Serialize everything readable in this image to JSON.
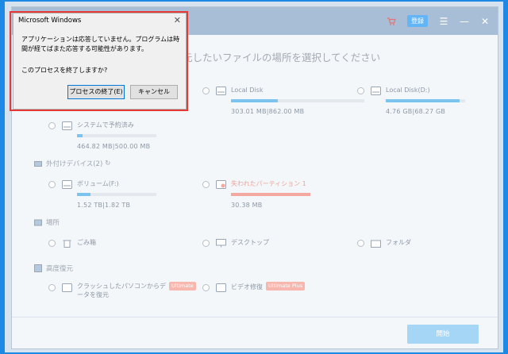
{
  "app": {
    "toolbar": {
      "login_label": "登録",
      "cart_icon": "cart-icon",
      "menu_icon": "menu-icon",
      "minimize_icon": "minimize-icon",
      "close_icon": "close-icon"
    },
    "headline": "元したいファイルの場所を選択してください",
    "drives": [
      {
        "name": "Local Disk",
        "size": "303.01  MB|862.00  MB",
        "used_fraction": 0.35
      },
      {
        "name": "Local Disk(D:)",
        "size": "4.76  GB|68.27  GB",
        "used_fraction": 0.93
      },
      {
        "name": "システムで予約済み",
        "size": "464.82  MB|500.00  MB",
        "used_fraction": 0.07
      }
    ],
    "external_section": {
      "title": "外付けデバイス(2)",
      "refresh_icon": "refresh-icon"
    },
    "external": [
      {
        "name": "ボリューム(F:)",
        "size": "1.52  TB|1.82  TB",
        "used_fraction": 0.17
      },
      {
        "name": "失われたパーティション 1",
        "size": "30.38  MB",
        "used_fraction": 1.0
      }
    ],
    "location_section": {
      "title": "場所"
    },
    "locations": [
      {
        "label": "ごみ箱",
        "icon": "trash-icon"
      },
      {
        "label": "デスクトップ",
        "icon": "desktop-icon"
      },
      {
        "label": "フォルダ",
        "icon": "folder-icon"
      }
    ],
    "advanced_section": {
      "title": "高度復元"
    },
    "advanced": [
      {
        "label": "クラッシュしたパソコンからデータを復元",
        "badge": "Ultimate",
        "icon": "crash-icon"
      },
      {
        "label": "ビデオ修復",
        "badge": "Ultimate Plus",
        "icon": "video-repair-icon"
      }
    ],
    "start_label": "開始"
  },
  "dialog": {
    "title": "Microsoft Windows",
    "message": "アプリケーションは応答していません。プログラムは時間が経てばまた応答する可能性があります。",
    "question": "このプロセスを終了しますか?",
    "end_button": "プロセスの終了(E)",
    "cancel_button": "キャンセル",
    "highlight_color": "#e53935"
  }
}
